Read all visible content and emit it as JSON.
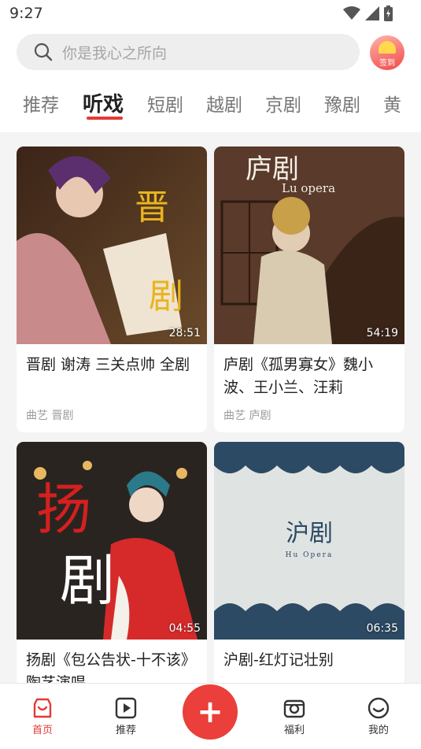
{
  "status_bar": {
    "time": "9:27"
  },
  "search": {
    "placeholder": "你是我心之所向"
  },
  "signin": {
    "label": "签到"
  },
  "tabs": [
    {
      "label": "推荐"
    },
    {
      "label": "听戏"
    },
    {
      "label": "短剧"
    },
    {
      "label": "越剧"
    },
    {
      "label": "京剧"
    },
    {
      "label": "豫剧"
    },
    {
      "label": "黄"
    }
  ],
  "active_tab": "听戏",
  "cards": [
    {
      "title": "晋剧 谢涛 三关点帅 全剧",
      "duration": "28:51",
      "tags": "曲艺 晋剧",
      "poster_text": [
        "晋",
        "剧"
      ]
    },
    {
      "title": "庐剧《孤男寡女》魏小波、王小兰、汪莉",
      "duration": "54:19",
      "tags": "曲艺 庐剧",
      "poster_text": [
        "庐剧",
        "Lu opera"
      ]
    },
    {
      "title": "扬剧《包公告状-十不该》陶艺演唱",
      "duration": "04:55",
      "tags": "",
      "poster_text": [
        "扬",
        "剧"
      ]
    },
    {
      "title": "沪剧-红灯记壮别",
      "duration": "06:35",
      "tags": "",
      "poster_text": [
        "沪剧",
        "Hu Opera"
      ]
    }
  ],
  "bottom_nav": [
    {
      "label": "首页"
    },
    {
      "label": "推荐"
    },
    {
      "label": "福利"
    },
    {
      "label": "我的"
    }
  ],
  "colors": {
    "accent": "#e53935",
    "fab": "#ea3f3a",
    "page_bg": "#f4f4f4"
  }
}
